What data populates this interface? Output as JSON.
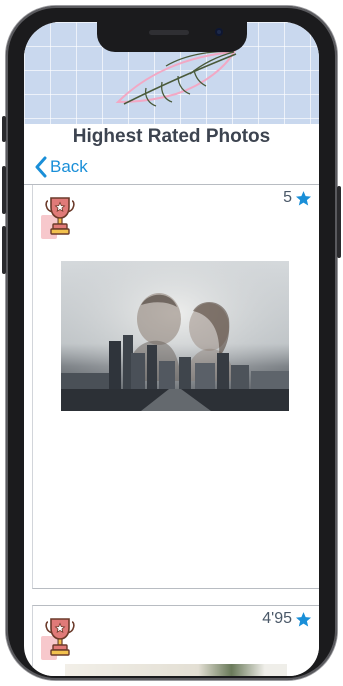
{
  "header": {
    "title": "Highest Rated Photos",
    "back_label": "Back"
  },
  "feed": {
    "items": [
      {
        "rating": "5",
        "rating_icon": "star-icon",
        "badge_icon": "trophy-icon",
        "image": "couple-skyline-photo"
      },
      {
        "rating": "4'95",
        "rating_icon": "star-icon",
        "badge_icon": "trophy-icon",
        "image": "photo-thumbnail"
      }
    ]
  },
  "colors": {
    "accent": "#1a8fd8",
    "banner": "#c9d8ee",
    "trophy": "#e07a78",
    "title": "#3d4450"
  }
}
